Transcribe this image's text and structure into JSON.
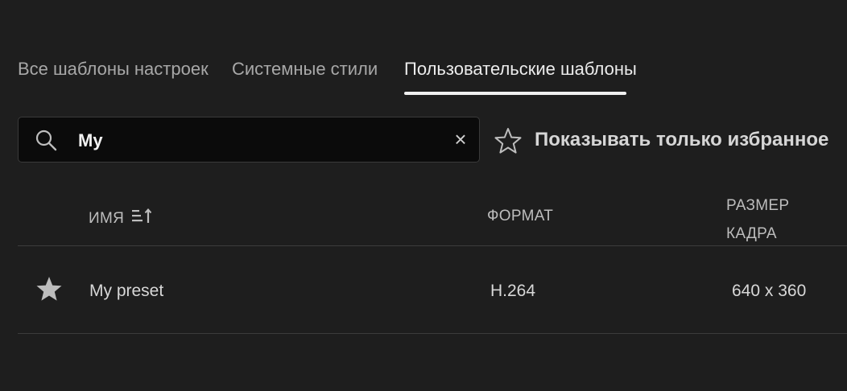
{
  "tabs": [
    {
      "label": "Все шаблоны настроек",
      "active": false
    },
    {
      "label": "Системные стили",
      "active": false
    },
    {
      "label": "Пользовательские шаблоны",
      "active": true
    }
  ],
  "search": {
    "value": "My",
    "icon": "search-icon",
    "clear_icon": "close-icon",
    "clear_glyph": "×"
  },
  "favorites_toggle": {
    "label": "Показывать только избранное",
    "icon": "star-outline-icon"
  },
  "table": {
    "columns": {
      "name": "ИМЯ",
      "format": "ФОРМАТ",
      "frame_size_line1": "РАЗМЕР",
      "frame_size_line2": "КАДРА"
    },
    "rows": [
      {
        "favorite": true,
        "name": "My preset",
        "format": "H.264",
        "frame_size": "640 x 360"
      }
    ]
  },
  "colors": {
    "background": "#1e1e1e",
    "search_bg": "#0b0b0b",
    "active_underline": "#f0f0f0",
    "text": "#cfcfcf"
  }
}
